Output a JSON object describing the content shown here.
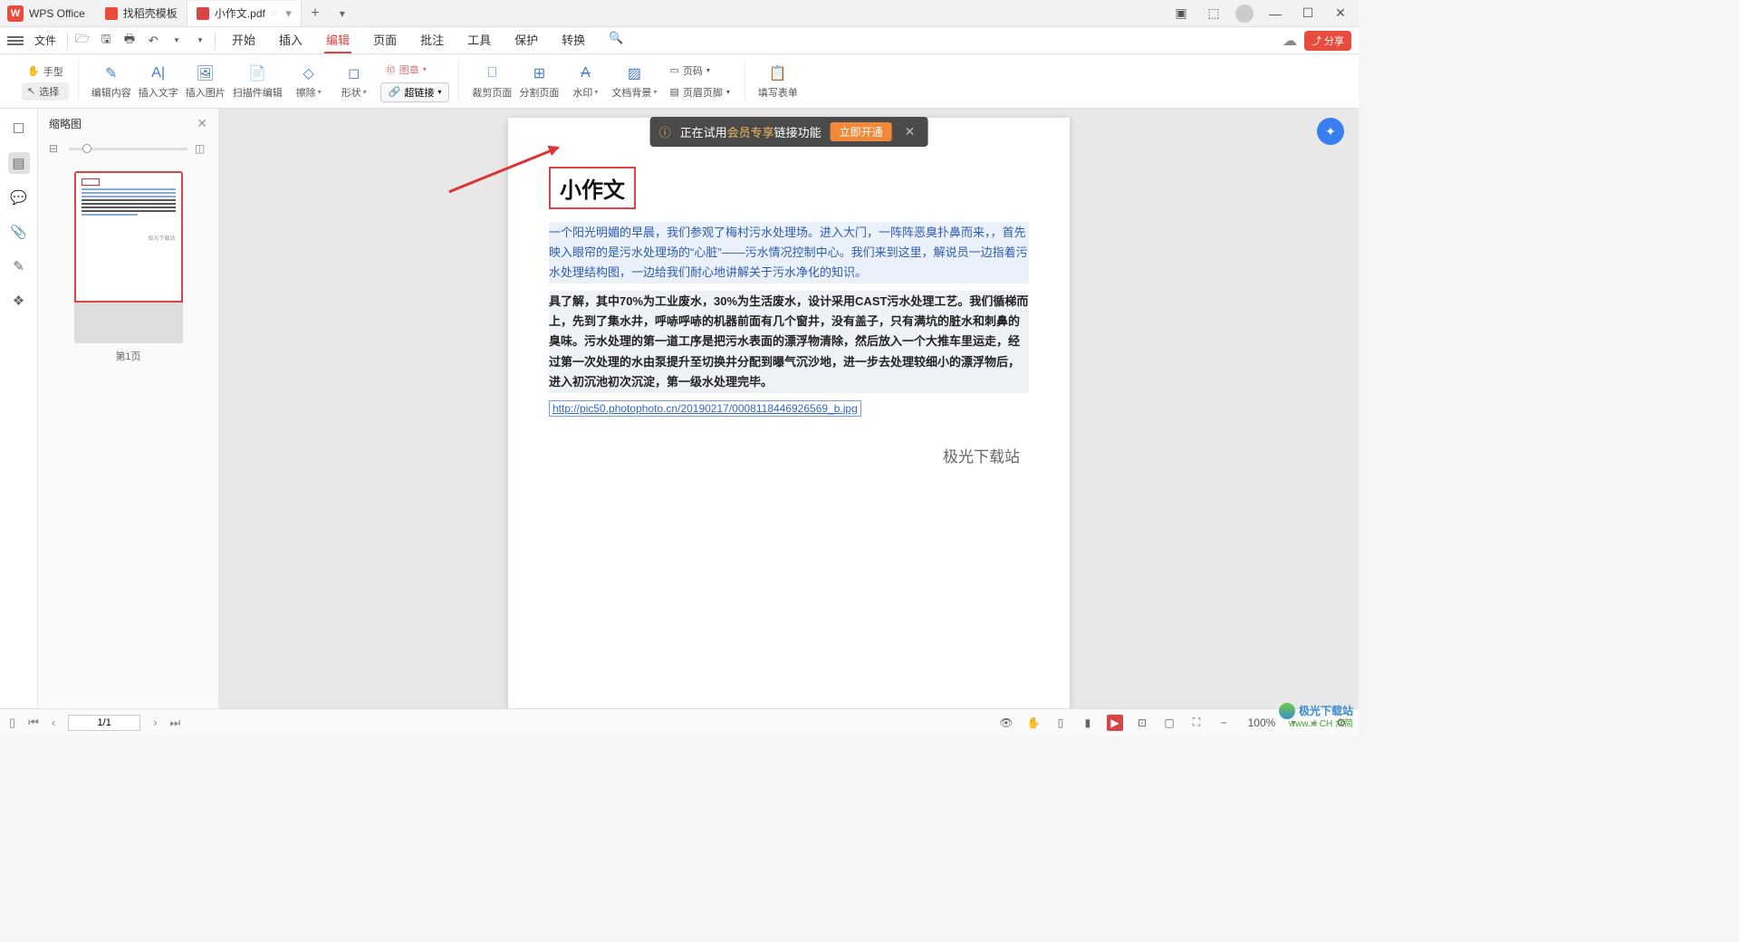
{
  "titlebar": {
    "app_name": "WPS Office",
    "tabs": [
      {
        "label": "找稻壳模板",
        "icon": "red"
      },
      {
        "label": "小作文.pdf",
        "icon": "pdf",
        "active": true
      }
    ]
  },
  "menubar": {
    "file": "文件",
    "tabs": {
      "start": "开始",
      "insert": "插入",
      "edit": "编辑",
      "page": "页面",
      "annotate": "批注",
      "tools": "工具",
      "protect": "保护",
      "convert": "转换"
    },
    "share": "分享"
  },
  "ribbon": {
    "mode_hand": "手型",
    "mode_select": "选择",
    "edit_content": "编辑内容",
    "insert_text": "插入文字",
    "insert_image": "插入图片",
    "scan_edit": "扫描件编辑",
    "erase": "擦除",
    "shape": "形状",
    "stamp": "图章",
    "hyperlink": "超链接",
    "crop_page": "裁剪页面",
    "split_page": "分割页面",
    "watermark": "水印",
    "doc_bg": "文档背景",
    "page_num": "页码",
    "header_footer": "页眉页脚",
    "fill_form": "填写表单"
  },
  "sidebar": {
    "thumb_title": "缩略图",
    "page_label": "第1页"
  },
  "notice": {
    "prefix": "正在试用",
    "highlight": "会员专享",
    "suffix": "链接功能",
    "btn": "立即开通"
  },
  "document": {
    "title": "小作文",
    "para1": "一个阳光明媚的早晨，我们参观了梅村污水处理场。进入大门，一阵阵恶臭扑鼻而来，，首先映入眼帘的是污水处理场的“心脏”——污水情况控制中心。我们来到这里，解说员一边指着污水处理结构图，一边给我们耐心地讲解关于污水净化的知识。",
    "para2": "具了解，其中70%为工业废水，30%为生活废水，设计采用CAST污水处理工艺。我们循梯而上，先到了集水井，呼哧呼哧的机器前面有几个窗井，没有盖子，只有满坑的脏水和刺鼻的臭味。污水处理的第一道工序是把污水表面的漂浮物清除，然后放入一个大推车里运走，经过第一次处理的水由泵提升至切换井分配到曝气沉沙地，进一步去处理较细小的漂浮物后，进入初沉池初次沉淀，第一级水处理完毕。",
    "link": "http://pic50.photophoto.cn/20190217/0008118446926569_b.jpg",
    "watermark": "极光下载站"
  },
  "statusbar": {
    "page": "1/1",
    "zoom": "100%"
  },
  "corner": {
    "text": "极光下载站",
    "sub": "www.xi CH 众简"
  }
}
